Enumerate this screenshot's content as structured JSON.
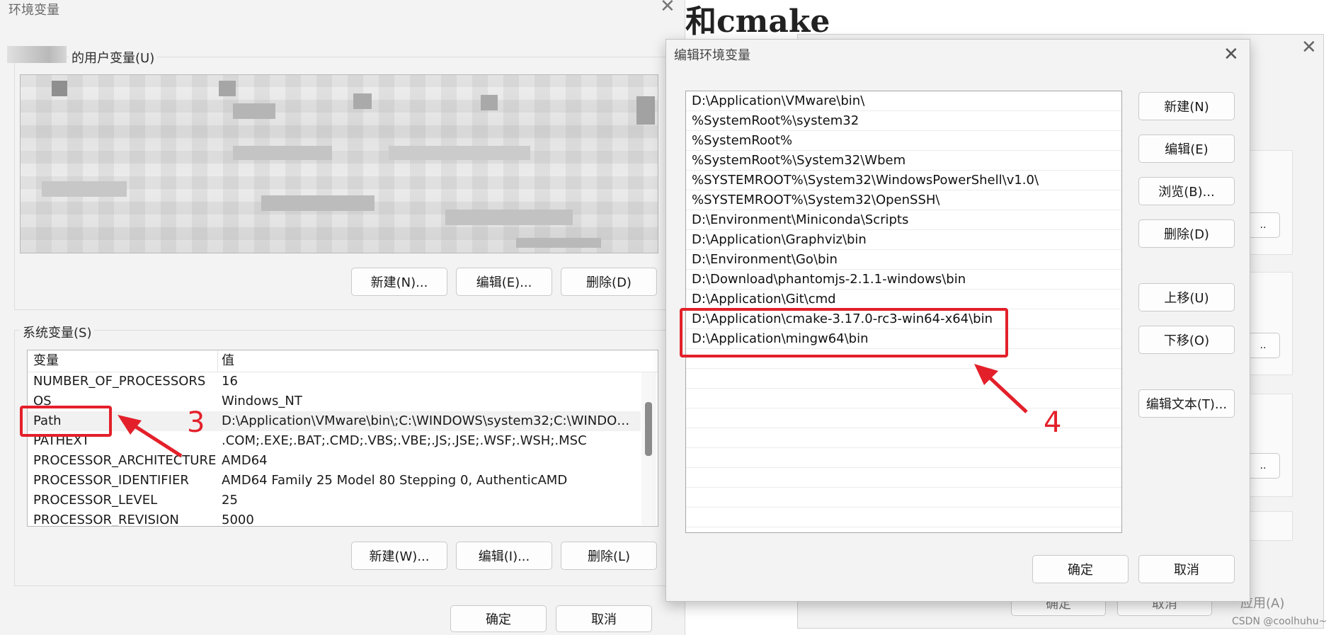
{
  "env_dialog": {
    "title": "环境变量",
    "close_icon": "close-icon",
    "user_section_label": "的用户变量(U)",
    "user_buttons": {
      "new": "新建(N)...",
      "edit": "编辑(E)...",
      "delete": "删除(D)"
    },
    "system_section_label": "系统变量(S)",
    "system_table": {
      "headers": [
        "变量",
        "值"
      ],
      "rows": [
        {
          "name": "NUMBER_OF_PROCESSORS",
          "value": "16"
        },
        {
          "name": "OS",
          "value": "Windows_NT"
        },
        {
          "name": "Path",
          "value": "D:\\Application\\VMware\\bin\\;C:\\WINDOWS\\system32;C:\\WINDOW..."
        },
        {
          "name": "PATHEXT",
          "value": ".COM;.EXE;.BAT;.CMD;.VBS;.VBE;.JS;.JSE;.WSF;.WSH;.MSC"
        },
        {
          "name": "PROCESSOR_ARCHITECTURE",
          "value": "AMD64"
        },
        {
          "name": "PROCESSOR_IDENTIFIER",
          "value": "AMD64 Family 25 Model 80 Stepping 0, AuthenticAMD"
        },
        {
          "name": "PROCESSOR_LEVEL",
          "value": "25"
        },
        {
          "name": "PROCESSOR_REVISION",
          "value": "5000"
        }
      ]
    },
    "system_buttons": {
      "new": "新建(W)...",
      "edit": "编辑(I)...",
      "delete": "删除(L)"
    },
    "ok": "确定",
    "cancel": "取消"
  },
  "edit_dialog": {
    "title": "编辑环境变量",
    "close_icon": "close-icon",
    "paths": [
      "D:\\Application\\VMware\\bin\\",
      "%SystemRoot%\\system32",
      "%SystemRoot%",
      "%SystemRoot%\\System32\\Wbem",
      "%SYSTEMROOT%\\System32\\WindowsPowerShell\\v1.0\\",
      "%SYSTEMROOT%\\System32\\OpenSSH\\",
      "D:\\Environment\\Miniconda\\Scripts",
      "D:\\Application\\Graphviz\\bin",
      "D:\\Environment\\Go\\bin",
      "D:\\Download\\phantomjs-2.1.1-windows\\bin",
      "D:\\Application\\Git\\cmd",
      "D:\\Application\\cmake-3.17.0-rc3-win64-x64\\bin",
      "D:\\Application\\mingw64\\bin"
    ],
    "buttons": {
      "new": "新建(N)",
      "edit": "编辑(E)",
      "browse": "浏览(B)...",
      "delete": "删除(D)",
      "move_up": "上移(U)",
      "move_down": "下移(O)",
      "edit_text": "编辑文本(T)..."
    },
    "ok": "确定",
    "cancel": "取消"
  },
  "background": {
    "heading": "和cmake",
    "behind_ok": "确定",
    "behind_cancel": "取消",
    "apply": "应用(A)",
    "watermark": "CSDN @coolhuhu~"
  },
  "annotations": {
    "step3": "3",
    "step4": "4"
  },
  "colors": {
    "callout": "#e3202a",
    "dialog_bg": "#f3f3f3",
    "selected_row": "#f1f1f1"
  }
}
